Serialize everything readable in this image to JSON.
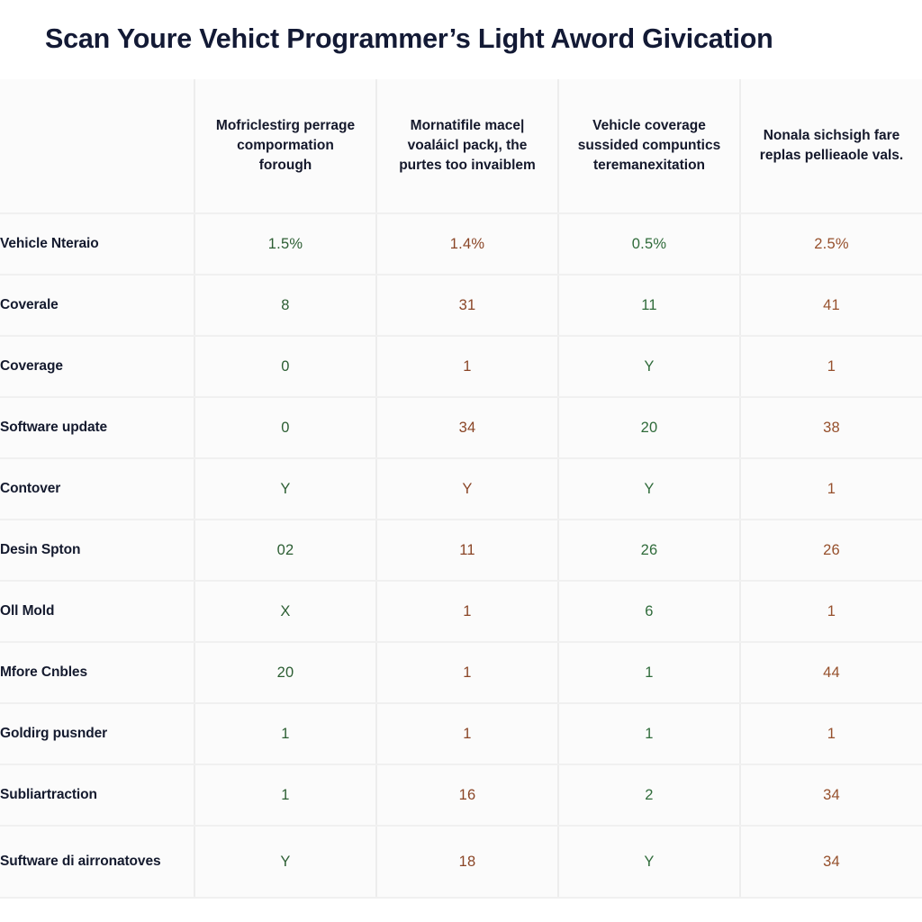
{
  "page": {
    "title": "Scan Youre Vehict Programmer’s Light Aword Givication",
    "title_color": "#131a35",
    "background": "#ffffff"
  },
  "colors": {
    "value_green": "#2c5e33",
    "value_brown": "#8a4526",
    "grid_line": "#ededed",
    "cell_background": "#fbfbfb",
    "label_text": "#141a2e"
  },
  "table": {
    "corner_header": "",
    "column_headers": [
      "Mofriclestirg perrage compormation forough",
      "Mornatifile mace| voaláicl packȷ, the purtes too invaiblem",
      "Vehicle coverage sussided compuntics teremanexitation",
      "Nonala sichsigh fare replas pellieaole vals."
    ],
    "rows": [
      {
        "label": "Vehicle Nteraio",
        "values": [
          "1.5%",
          "1.4%",
          "0.5%",
          "2.5%"
        ],
        "value_colors": [
          "green",
          "brown",
          "green",
          "brown"
        ]
      },
      {
        "label": "Coverale",
        "values": [
          "8",
          "31",
          "11",
          "41"
        ],
        "value_colors": [
          "green",
          "brown",
          "green",
          "brown"
        ]
      },
      {
        "label": "Coverage",
        "values": [
          "0",
          "1",
          "Y",
          "1"
        ],
        "value_colors": [
          "green",
          "brown",
          "green",
          "brown"
        ]
      },
      {
        "label": "Software update",
        "values": [
          "0",
          "34",
          "20",
          "38"
        ],
        "value_colors": [
          "green",
          "brown",
          "green",
          "brown"
        ]
      },
      {
        "label": "Contover",
        "values": [
          "Y",
          "Y",
          "Y",
          "1"
        ],
        "value_colors": [
          "green",
          "brown",
          "green",
          "brown"
        ]
      },
      {
        "label": "Desin Spton",
        "values": [
          "02",
          "11",
          "26",
          "26"
        ],
        "value_colors": [
          "green",
          "brown",
          "green",
          "brown"
        ]
      },
      {
        "label": "Oll Mold",
        "values": [
          "X",
          "1",
          "6",
          "1"
        ],
        "value_colors": [
          "green",
          "brown",
          "green",
          "brown"
        ]
      },
      {
        "label": "Mfore Cnbles",
        "values": [
          "20",
          "1",
          "1",
          "44"
        ],
        "value_colors": [
          "green",
          "brown",
          "green",
          "brown"
        ]
      },
      {
        "label": "Goldirg pusnder",
        "values": [
          "1",
          "1",
          "1",
          "1"
        ],
        "value_colors": [
          "green",
          "brown",
          "green",
          "brown"
        ]
      },
      {
        "label": "Subliartraction",
        "values": [
          "1",
          "16",
          "2",
          "34"
        ],
        "value_colors": [
          "green",
          "brown",
          "green",
          "brown"
        ]
      },
      {
        "label": "Suftware di airronatoves",
        "values": [
          "Y",
          "18",
          "Y",
          "34"
        ],
        "value_colors": [
          "green",
          "brown",
          "green",
          "brown"
        ]
      }
    ]
  }
}
